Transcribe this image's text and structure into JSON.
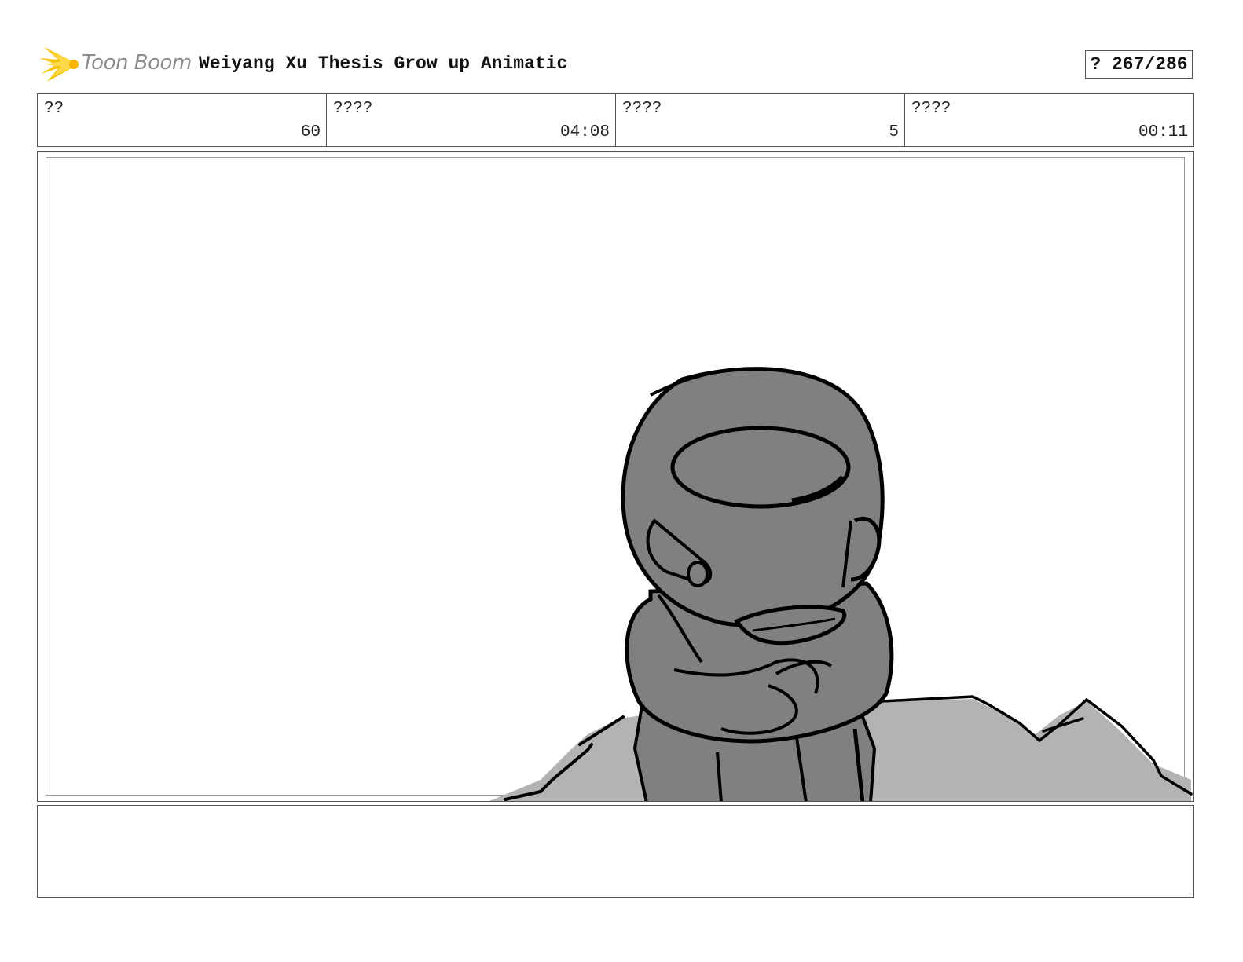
{
  "header": {
    "logo_text": "Toon Boom",
    "title": "Weiyang Xu Thesis Grow up Animatic",
    "page_counter": "? 267/286"
  },
  "info": [
    {
      "label": "??",
      "value": "60"
    },
    {
      "label": "????",
      "value": "04:08"
    },
    {
      "label": "????",
      "value": "5"
    },
    {
      "label": "????",
      "value": "00:11"
    }
  ],
  "panel": {
    "image": "storyboard-sketch-character-sitting-on-rocks"
  },
  "notes": {
    "text": ""
  },
  "colors": {
    "logo": "#f5c400",
    "border": "#555555",
    "sketch_fill": "#808080",
    "rock_fill": "#b3b3b3"
  }
}
